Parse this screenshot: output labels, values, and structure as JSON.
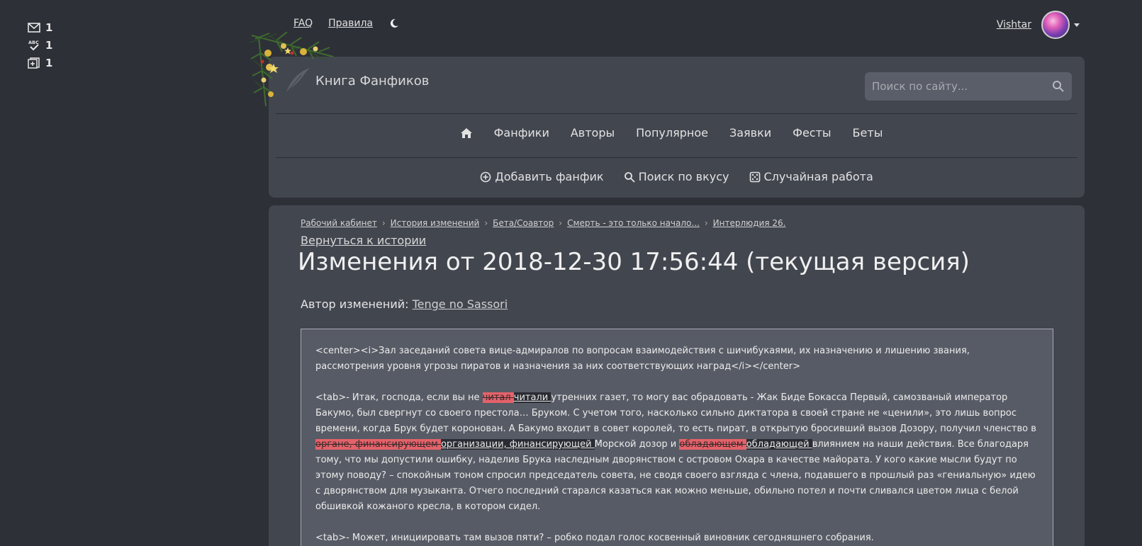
{
  "counters": [
    {
      "icon": "envelope-icon",
      "count": "1"
    },
    {
      "icon": "spellcheck-icon",
      "count": "1"
    },
    {
      "icon": "card-plus-icon",
      "count": "1"
    }
  ],
  "topbar": {
    "faq": "FAQ",
    "rules": "Правила",
    "theme_icon": "moon-icon",
    "username": "Vishtar"
  },
  "header": {
    "site_name": "Книга Фанфиков",
    "search_placeholder": "Поиск по сайту...",
    "nav_primary": [
      "Фанфики",
      "Авторы",
      "Популярное",
      "Заявки",
      "Фесты",
      "Беты"
    ],
    "nav_secondary": {
      "add": "Добавить фанфик",
      "taste": "Поиск по вкусу",
      "random": "Случайная работа"
    }
  },
  "breadcrumb": [
    "Рабочий кабинет",
    "История изменений",
    "Бета/Соавтор",
    "Смерть - это только начало...",
    "Интерлюдия 26."
  ],
  "back_link": "Вернуться к истории",
  "title": "Изменения от 2018-12-30 17:56:44 (текущая версия)",
  "author": {
    "label": "Автор изменений:",
    "name": "Tenge no Sassori"
  },
  "diff": {
    "p1": "<center><i>Зал заседаний совета вице-адмиралов по вопросам взаимодействия с шичибукаями, их назначению и лишению звания, рассмотрения уровня угрозы пиратов и назначения за них соответствующих наград</i></center>",
    "p2_a": "<tab>- Итак, господа, если вы не ",
    "p2_del1": "читал ",
    "p2_ins1": "читали ",
    "p2_b": "утренних газет, то могу вас обрадовать - Жак Биде Бокасса Первый, самозваный император Бакумо, был свергнут со своего престола… Бруком. С учетом того, насколько сильно диктатора в своей стране не «ценили», это лишь вопрос времени, когда Брук будет коронован. А Бакумо входит в совет королей, то есть пират, в открытую бросивший вызов Дозору, получил членство в ",
    "p2_del2": "органе, финансирующем ",
    "p2_ins2": "организации, финансирующей ",
    "p2_c": "Морской дозор и ",
    "p2_del3": "обладающем ",
    "p2_ins3": "обладающей ",
    "p2_d": "влиянием на наши действия. Все благодаря тому, что мы допустили ошибку, наделив Брука наследным дворянством с островом Охара в качестве майората. У кого какие мысли будут по этому поводу? – спокойным тоном спросил председатель совета, не сводя своего взгляда с члена, подавшего в прошлый раз «гениальную» идею с дворянством для музыканта. Отчего последний старался казаться как можно меньше, обильно потел и почти сливался цветом лица с белой обшивкой кожаного кресла, в котором сидел.",
    "p3": "<tab>- Может, инициировать там вызов пяти? – робко подал голос косвенный виновник сегодняшнего собрания."
  }
}
